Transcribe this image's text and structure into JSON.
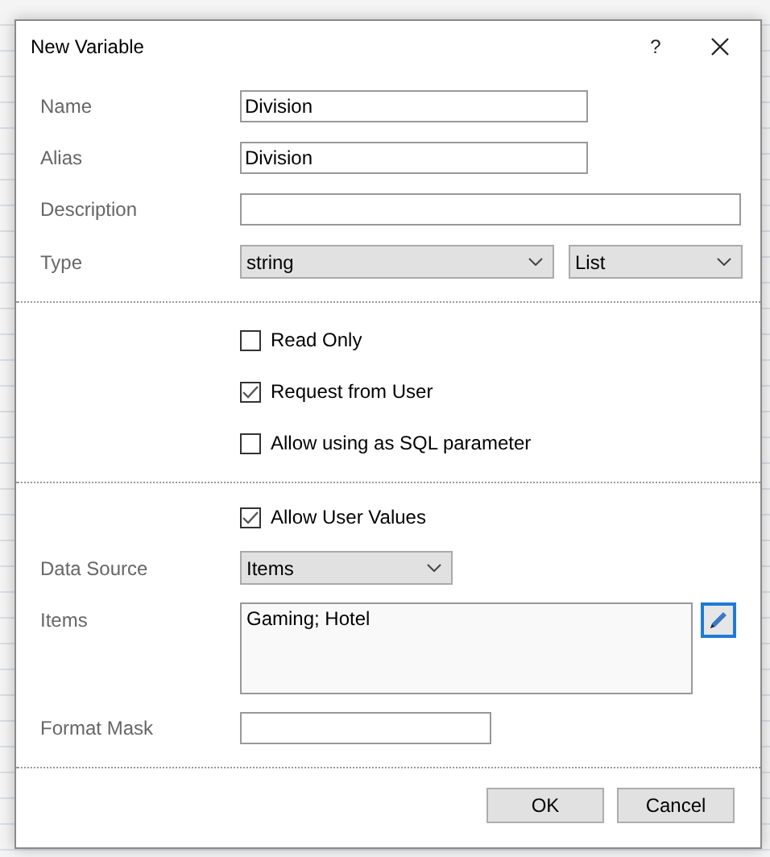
{
  "dialog": {
    "title": "New Variable",
    "help": "?"
  },
  "sections": [
    {
      "rows": [
        {
          "kind": "short",
          "label": "Name",
          "value": "Division"
        },
        {
          "kind": "short",
          "label": "Alias",
          "value": "Division"
        },
        {
          "kind": "long",
          "label": "Description"
        },
        {
          "kind": "pair",
          "label": "Type",
          "value": "string",
          "value_2": "List"
        }
      ]
    },
    {
      "rows": [
        {
          "kind": "check",
          "text": "Read Only",
          "checked": false
        },
        {
          "kind": "check",
          "text": "Request from User",
          "checked": true
        },
        {
          "kind": "check",
          "text": "Allow using as SQL parameter",
          "checked": false
        }
      ]
    },
    {
      "rows": [
        {
          "kind": "check",
          "text": "Allow User Values",
          "checked": true
        },
        {
          "kind": "dropdown",
          "label": "Data Source",
          "value": "Items"
        },
        {
          "kind": "memo",
          "label": "Items",
          "value": "Gaming; Hotel"
        },
        {
          "kind": "mask",
          "label": "Format Mask"
        }
      ]
    }
  ],
  "buttons": [
    "OK",
    "Cancel"
  ]
}
